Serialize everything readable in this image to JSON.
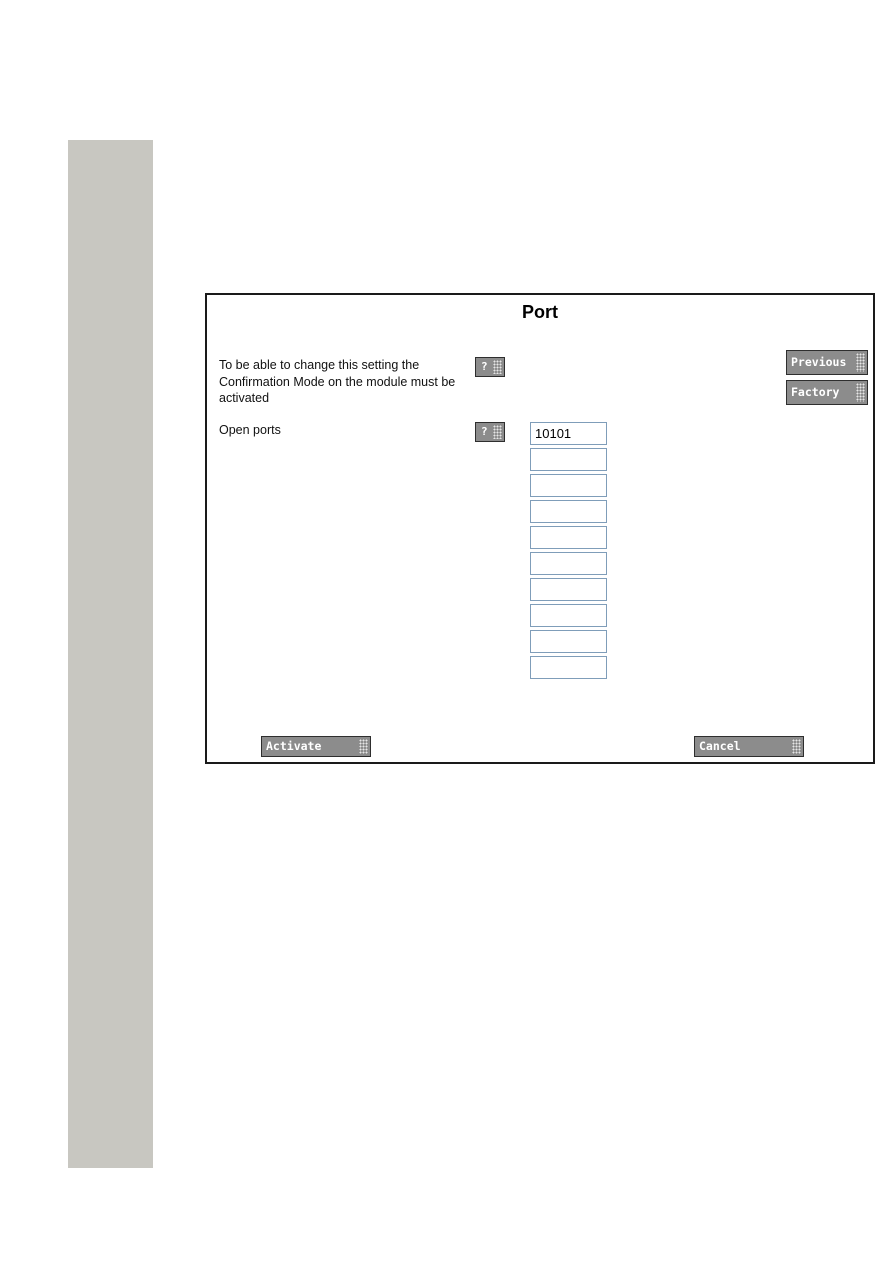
{
  "page": {
    "title": "Port"
  },
  "settings": [
    {
      "label": "To be able to change this setting the Confirmation Mode on the module must be activated",
      "help_label": "?"
    },
    {
      "label": "Open ports",
      "help_label": "?"
    }
  ],
  "open_ports": [
    "10101",
    "",
    "",
    "",
    "",
    "",
    "",
    "",
    "",
    ""
  ],
  "side_buttons": {
    "previous": "Previous",
    "factory": "Factory"
  },
  "footer_buttons": {
    "activate": "Activate",
    "cancel": "Cancel"
  },
  "colors": {
    "sidebar": "#c8c7c1",
    "button": "#8c8c8c",
    "input_border": "#7f9db9"
  }
}
